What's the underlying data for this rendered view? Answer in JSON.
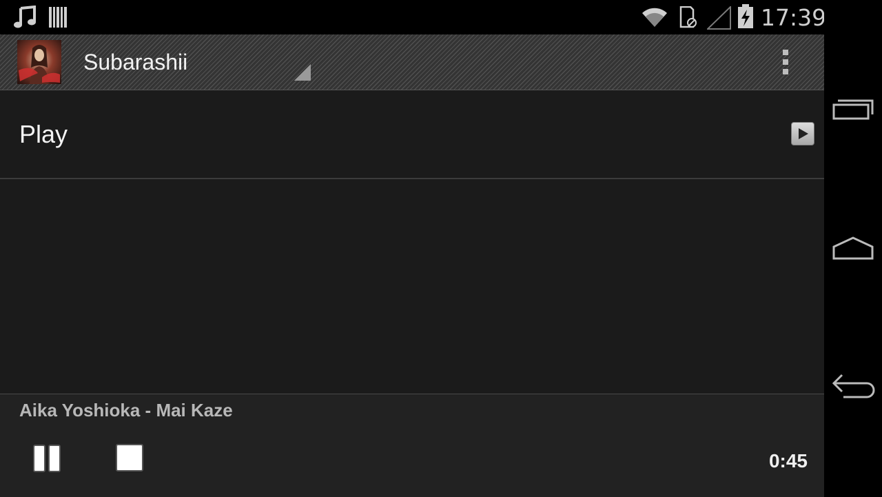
{
  "status_bar": {
    "time": "17:39",
    "left_icons": [
      "music-note-icon",
      "barcode-icon"
    ],
    "right_icons": [
      "wifi-icon",
      "sd-card-blocked-icon",
      "signal-icon",
      "battery-charging-icon"
    ]
  },
  "action_bar": {
    "title": "Subarashii",
    "album_art": "album-art-thumbnail",
    "overflow_icon": "overflow-menu-icon"
  },
  "list": {
    "items": [
      {
        "label": "Play",
        "icon": "play-icon"
      }
    ]
  },
  "player": {
    "track": "Aika Yoshioka - Mai Kaze",
    "elapsed": "0:45",
    "controls": [
      "pause-icon",
      "stop-icon"
    ]
  },
  "nav_bar": {
    "buttons": [
      "recent-apps-icon",
      "home-icon",
      "back-icon"
    ]
  },
  "colors": {
    "background": "#1b1b1b",
    "action_bar": "#3a3a3a",
    "player": "#222222",
    "text": "#f2f2f2"
  }
}
